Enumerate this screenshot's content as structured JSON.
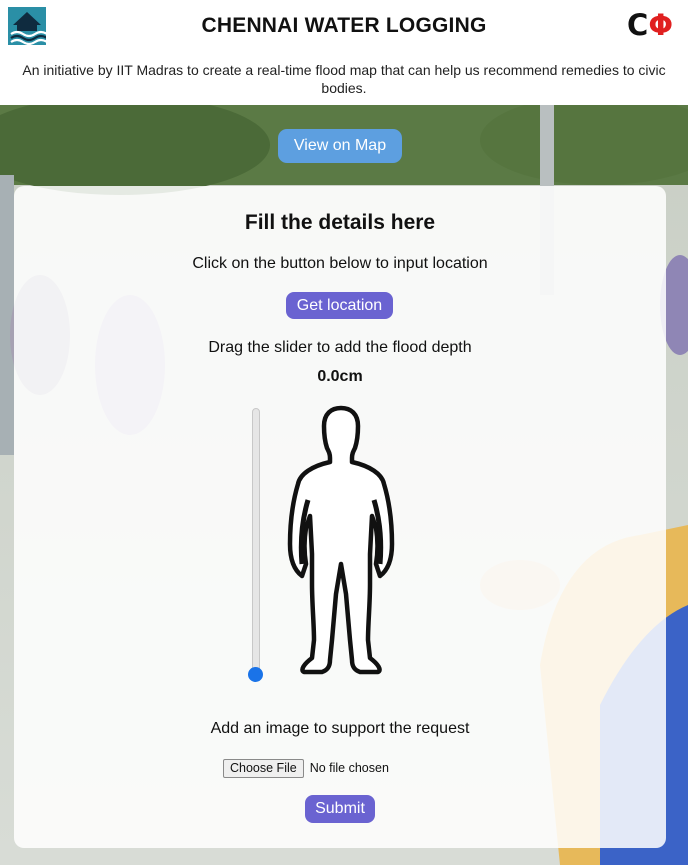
{
  "header": {
    "title": "CHENNAI WATER LOGGING",
    "brand_c": "C",
    "brand_phi": "Φ",
    "tagline": "An initiative by IIT Madras to create a real-time flood map that can help us recommend remedies to civic bodies.",
    "logo_icon": "flood-house-icon"
  },
  "actions": {
    "view_map_label": "View on Map"
  },
  "form": {
    "title": "Fill the details here",
    "location_hint": "Click on the button below to input location",
    "get_location_label": "Get location",
    "slider_hint": "Drag the slider to add the flood depth",
    "depth_value": "0.0cm",
    "depth_cm": 0.0,
    "image_hint": "Add an image to support the request",
    "choose_file_label": "Choose File",
    "file_status": "No file chosen",
    "submit_label": "Submit",
    "figure_icon": "person-silhouette-icon"
  },
  "colors": {
    "view_map_button": "#5d9fe0",
    "purple_button": "#6a63d1",
    "slider_thumb": "#1a73e8",
    "brand_phi": "#e02020"
  }
}
